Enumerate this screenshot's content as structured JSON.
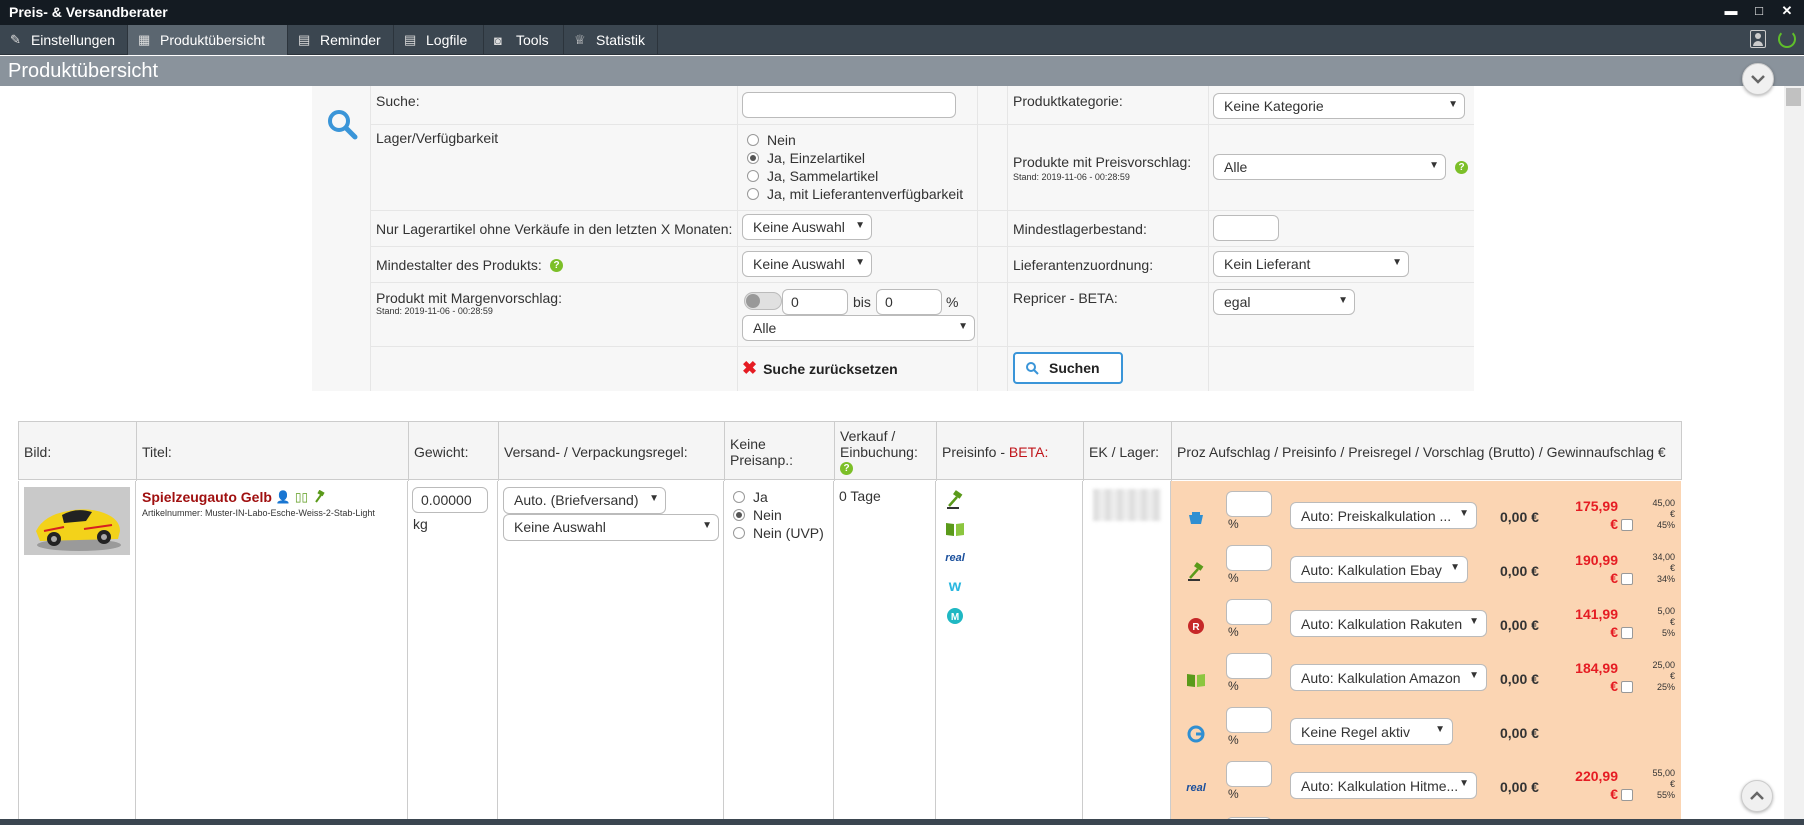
{
  "window": {
    "title": "Preis- & Versandberater",
    "minimize": "▬",
    "maximize": "□",
    "close": "✕"
  },
  "menu": {
    "items": [
      {
        "label": "Einstellungen",
        "icon": "settings-pencil-icon",
        "glyph": "✎"
      },
      {
        "label": "Produktübersicht",
        "icon": "grid-icon",
        "glyph": "▦",
        "active": true
      },
      {
        "label": "Reminder",
        "icon": "calculator-icon",
        "glyph": "▤"
      },
      {
        "label": "Logfile",
        "icon": "calculator-icon",
        "glyph": "▤"
      },
      {
        "label": "Tools",
        "icon": "tools-icon",
        "glyph": "◙"
      },
      {
        "label": "Statistik",
        "icon": "statistics-icon",
        "glyph": "♕"
      }
    ]
  },
  "page": {
    "title": "Produktübersicht"
  },
  "search": {
    "suche_label": "Suche:",
    "suche_value": "",
    "produktkategorie_label": "Produktkategorie:",
    "produktkategorie_value": "Keine Kategorie",
    "lager_label": "Lager/Verfügbarkeit",
    "lager_options": [
      {
        "label": "Nein",
        "checked": false
      },
      {
        "label": "Ja, Einzelartikel",
        "checked": true
      },
      {
        "label": "Ja, Sammelartikel",
        "checked": false
      },
      {
        "label": "Ja, mit Lieferantenverfügbarkeit",
        "checked": false
      }
    ],
    "preisvorschlag_label": "Produkte mit Preisvorschlag:",
    "preisvorschlag_stand": "Stand: 2019-11-06 - 00:28:59",
    "preisvorschlag_value": "Alle",
    "lagerartikel_label": "Nur Lagerartikel ohne Verkäufe in den letzten X Monaten:",
    "lagerartikel_value": "Keine Auswahl",
    "mindestlager_label": "Mindestlagerbestand:",
    "mindestlager_value": "",
    "mindestalter_label": "Mindestalter des Produkts:",
    "mindestalter_value": "Keine Auswahl",
    "lieferant_label": "Lieferantenzuordnung:",
    "lieferant_value": "Kein Lieferant",
    "marge_label": "Produkt mit Margenvorschlag:",
    "marge_stand": "Stand: 2019-11-06 - 00:28:59",
    "marge_from": "0",
    "marge_bis": "bis",
    "marge_to": "0",
    "marge_pct": "%",
    "marge_select": "Alle",
    "repricer_label": "Repricer - BETA:",
    "repricer_value": "egal",
    "reset_label": "Suche zurücksetzen",
    "search_button": "Suchen"
  },
  "table": {
    "headers": {
      "bild": "Bild:",
      "titel": "Titel:",
      "gewicht": "Gewicht:",
      "versand": "Versand- / Verpackungsregel:",
      "preisanp": "Keine Preisanp.:",
      "verkauf": "Verkauf / Einbuchung:",
      "preisinfo": "Preisinfo - ",
      "preisinfo_beta": "BETA:",
      "ek": "EK / Lager:",
      "proz": "Proz Aufschlag / Preisinfo / Preisregel / Vorschlag (Brutto) / Gewinnaufschlag €"
    },
    "row": {
      "title": "Spielzeugauto Gelb",
      "artikelnummer": "Artikelnummer: Muster-IN-Labo-Esche-Weiss-2-Stab-Light",
      "gewicht": "0.00000",
      "gewicht_unit": "kg",
      "versand_select": "Auto. (Briefversand)",
      "verpackung_select": "Keine Auswahl",
      "preisanp_options": [
        {
          "label": "Ja",
          "checked": false
        },
        {
          "label": "Nein",
          "checked": true
        },
        {
          "label": "Nein (UVP)",
          "checked": false
        }
      ],
      "verkauf": "0 Tage",
      "preisinfo_icons": [
        "ebay-hammer-icon",
        "amazon-book-icon",
        "real-icon",
        "wish-icon",
        "marketplace-m-icon"
      ],
      "marketplaces": [
        {
          "icon": "shop-basket-icon",
          "rule": "Auto: Preiskalkulation ...",
          "zero": "0,00 €",
          "price": "175,99",
          "currency": "€",
          "gain": "45,00",
          "gain_cur": "€",
          "gain_pct": "45%"
        },
        {
          "icon": "ebay-hammer-icon",
          "rule": "Auto: Kalkulation Ebay",
          "zero": "0,00 €",
          "price": "190,99",
          "currency": "€",
          "gain": "34,00",
          "gain_cur": "€",
          "gain_pct": "34%"
        },
        {
          "icon": "rakuten-r-icon",
          "rule": "Auto: Kalkulation Rakuten",
          "zero": "0,00 €",
          "price": "141,99",
          "currency": "€",
          "gain": "5,00",
          "gain_cur": "€",
          "gain_pct": "5%"
        },
        {
          "icon": "amazon-book-icon",
          "rule": "Auto: Kalkulation Amazon",
          "zero": "0,00 €",
          "price": "184,99",
          "currency": "€",
          "gain": "25,00",
          "gain_cur": "€",
          "gain_pct": "25%"
        },
        {
          "icon": "google-icon",
          "rule": "Keine Regel aktiv",
          "zero": "0,00 €",
          "price": "",
          "currency": "",
          "gain": "",
          "gain_cur": "",
          "gain_pct": ""
        },
        {
          "icon": "real-icon",
          "rule": "Auto: Kalkulation Hitme...",
          "zero": "0,00 €",
          "price": "220,99",
          "currency": "€",
          "gain": "55,00",
          "gain_cur": "€",
          "gain_pct": "55%"
        }
      ]
    }
  },
  "colors": {
    "titlebar": "#141b22",
    "menubar": "#3b4650",
    "page_header": "#8a939c",
    "price_zone": "#fbd5b3",
    "price_red": "#e51c23",
    "help_green": "#7cbf28",
    "search_blue": "#3a95d8",
    "title_red": "#a01010"
  }
}
